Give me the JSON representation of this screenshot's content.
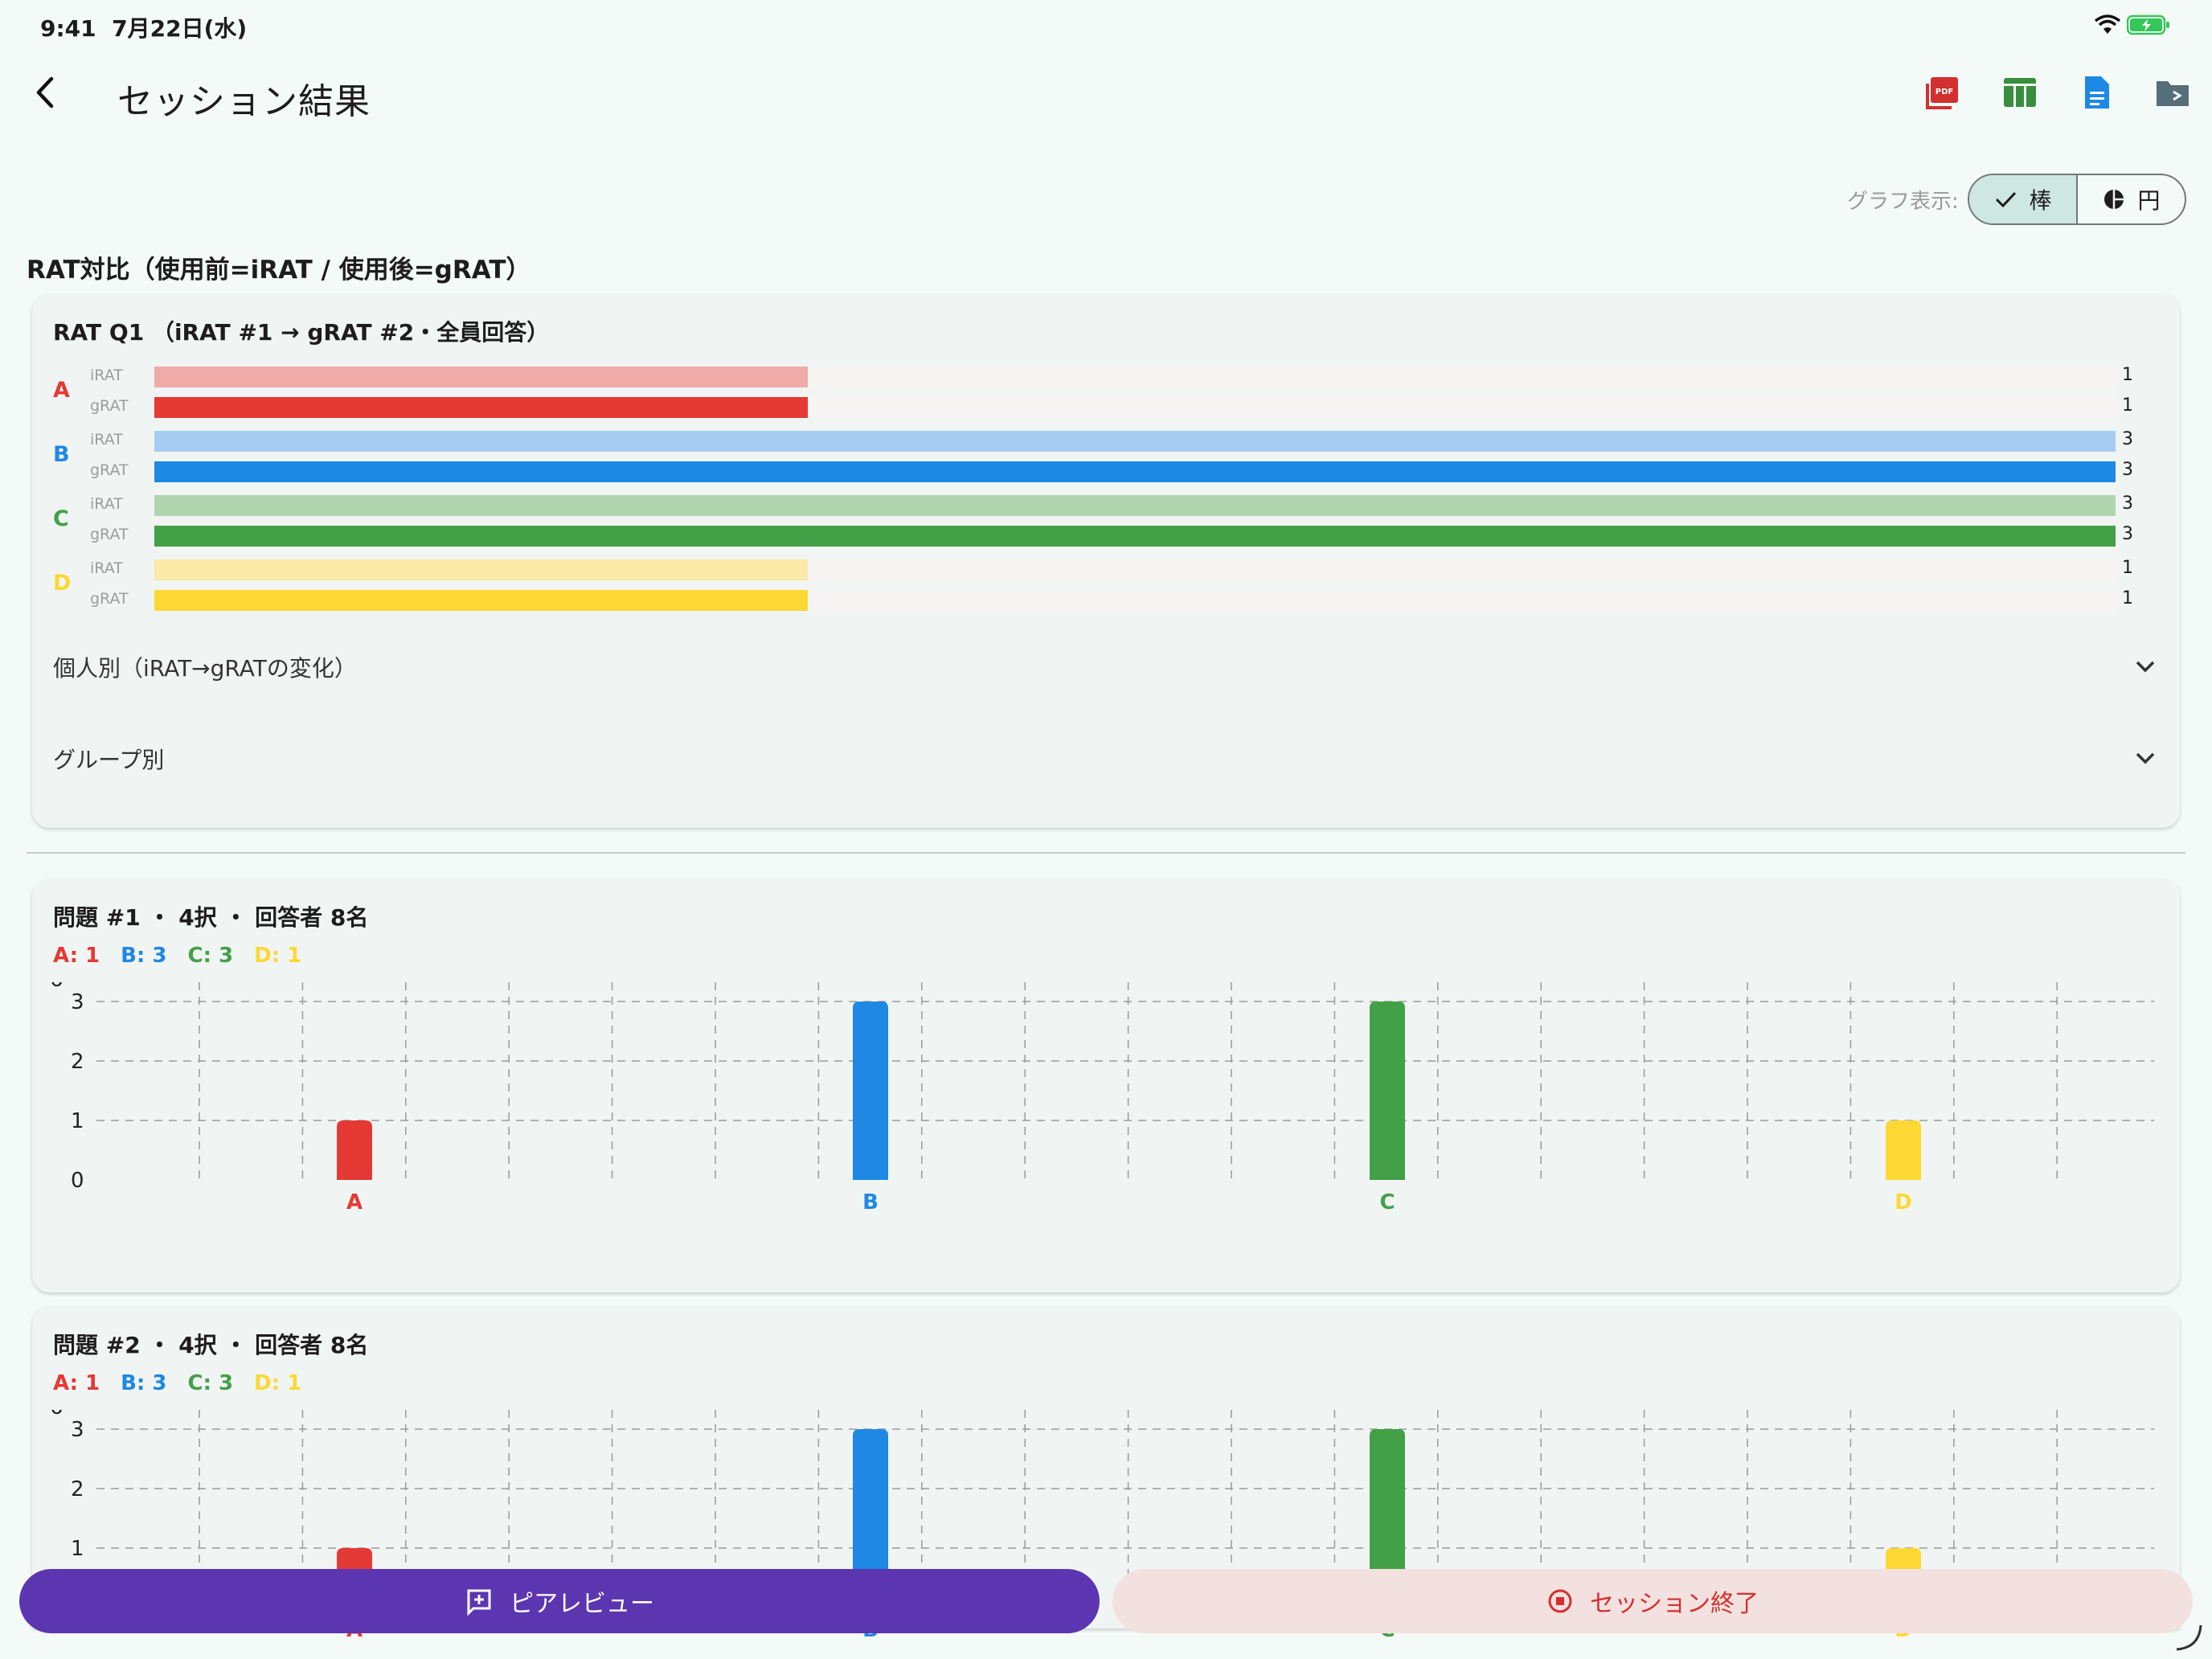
{
  "status_bar": {
    "time": "9:41",
    "date": "7月22日(水)",
    "icons": [
      "wifi-icon",
      "battery-charging-icon"
    ]
  },
  "app_bar": {
    "title": "セッション結果",
    "actions": [
      {
        "icon": "pdf-icon",
        "color": "#d32f2f"
      },
      {
        "icon": "table-icon",
        "color": "#388e3c"
      },
      {
        "icon": "document-icon",
        "color": "#1e88e5"
      },
      {
        "icon": "folder-export-icon",
        "color": "#546e7a"
      }
    ]
  },
  "graph_toggle": {
    "label": "グラフ表示:",
    "bar": "棒",
    "pie": "円",
    "selected": "bar"
  },
  "rat_section": {
    "title": "RAT対比（使用前=iRAT / 使用後=gRAT）",
    "card_title": "RAT Q1 （iRAT #1 → gRAT #2・全員回答）",
    "max_value": 3,
    "rows": [
      {
        "option": "A",
        "color": "#e53935",
        "light": "#f0aaa8",
        "irat_label": "iRAT",
        "grat_label": "gRAT",
        "irat": 1,
        "grat": 1
      },
      {
        "option": "B",
        "color": "#1e88e5",
        "light": "#a6cdf1",
        "irat_label": "iRAT",
        "grat_label": "gRAT",
        "irat": 3,
        "grat": 3
      },
      {
        "option": "C",
        "color": "#43a047",
        "light": "#b0d5af",
        "irat_label": "iRAT",
        "grat_label": "gRAT",
        "irat": 3,
        "grat": 3
      },
      {
        "option": "D",
        "color": "#fdd835",
        "light": "#fbe9a7",
        "irat_label": "iRAT",
        "grat_label": "gRAT",
        "irat": 1,
        "grat": 1
      }
    ],
    "expanders": [
      "個人別（iRAT→gRATの変化）",
      "グループ別"
    ]
  },
  "questions": [
    {
      "title": "問題 #1 ・ 4択 ・ 回答者 8名",
      "counts": [
        {
          "text": "A: 1",
          "color": "#e53935"
        },
        {
          "text": "B: 3",
          "color": "#1e88e5"
        },
        {
          "text": "C: 3",
          "color": "#43a047"
        },
        {
          "text": "D: 1",
          "color": "#fdd835"
        }
      ]
    },
    {
      "title": "問題 #2 ・ 4択 ・ 回答者 8名",
      "counts": [
        {
          "text": "A: 1",
          "color": "#e53935"
        },
        {
          "text": "B: 3",
          "color": "#1e88e5"
        },
        {
          "text": "C: 3",
          "color": "#43a047"
        },
        {
          "text": "D: 1",
          "color": "#fdd835"
        }
      ]
    }
  ],
  "chart_data": [
    {
      "type": "bar",
      "categories": [
        "A",
        "B",
        "C",
        "D"
      ],
      "values": [
        1,
        3,
        3,
        1
      ],
      "colors": [
        "#e53935",
        "#1e88e5",
        "#43a047",
        "#fdd835"
      ],
      "ylim": [
        0,
        3
      ],
      "yticks": [
        "0",
        "1",
        "2",
        "3",
        "6"
      ],
      "grid": true
    },
    {
      "type": "bar",
      "categories": [
        "A",
        "B",
        "C",
        "D"
      ],
      "values": [
        1,
        3,
        3,
        1
      ],
      "colors": [
        "#e53935",
        "#1e88e5",
        "#43a047",
        "#fdd835"
      ],
      "ylim": [
        0,
        3
      ],
      "yticks": [
        "0",
        "1",
        "2",
        "3",
        "6"
      ],
      "grid": true
    }
  ],
  "bottom_actions": {
    "peer_review": {
      "label": "ピアレビュー",
      "icon": "add-comment-icon"
    },
    "end_session": {
      "label": "セッション終了",
      "icon": "stop-circle-icon"
    }
  }
}
